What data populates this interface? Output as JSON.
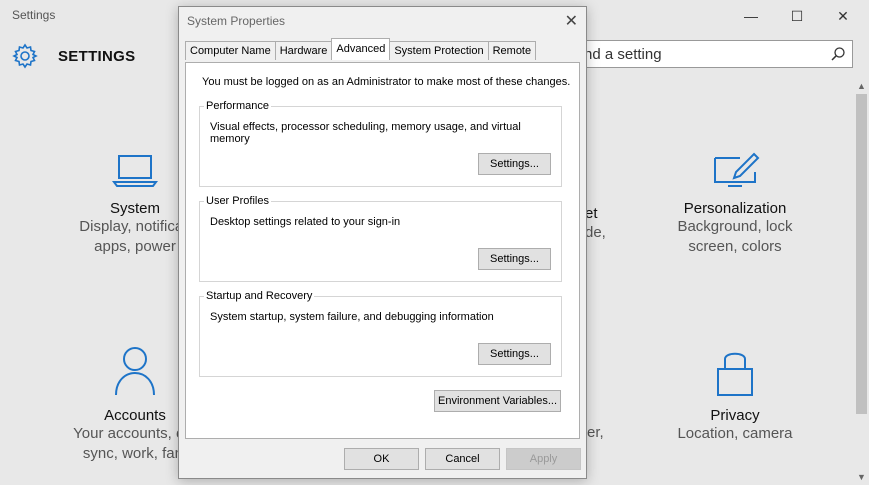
{
  "settings": {
    "window_title": "Settings",
    "controls": {
      "minimize": "—",
      "maximize": "☐",
      "close": "✕"
    },
    "header_label": "SETTINGS",
    "search_placeholder": "nd a setting",
    "tiles": {
      "system": {
        "name": "System",
        "line1": "Display, notificati",
        "line2": "apps, power"
      },
      "network": {
        "line1": "et",
        "line2": "de,"
      },
      "personalization": {
        "name": "Personalization",
        "line1": "Background, lock",
        "line2": "screen, colors"
      },
      "accounts": {
        "name": "Accounts",
        "line1": "Your accounts, em",
        "line2": "sync, work, fam"
      },
      "time": {
        "line1": "er,"
      },
      "privacy": {
        "name": "Privacy",
        "line1": "Location, camera"
      }
    },
    "accent_color": "#1e74c8"
  },
  "dialog": {
    "title": "System Properties",
    "tabs": [
      "Computer Name",
      "Hardware",
      "Advanced",
      "System Protection",
      "Remote"
    ],
    "active_tab": "Advanced",
    "note": "You must be logged on as an Administrator to make most of these changes.",
    "performance": {
      "label": "Performance",
      "desc": "Visual effects, processor scheduling, memory usage, and virtual memory",
      "button": "Settings..."
    },
    "user_profiles": {
      "label": "User Profiles",
      "desc": "Desktop settings related to your sign-in",
      "button": "Settings..."
    },
    "startup": {
      "label": "Startup and Recovery",
      "desc": "System startup, system failure, and debugging information",
      "button": "Settings..."
    },
    "env_button": "Environment Variables...",
    "ok": "OK",
    "cancel": "Cancel",
    "apply": "Apply"
  }
}
